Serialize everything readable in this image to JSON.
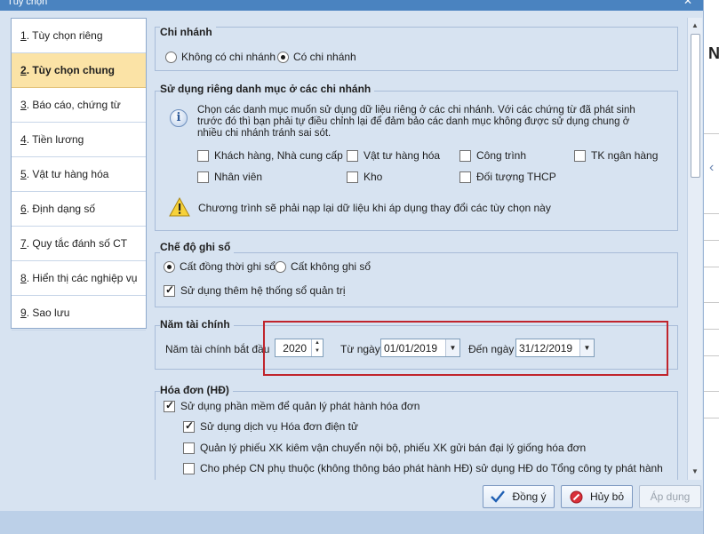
{
  "window": {
    "title": "Tùy chọn",
    "close_glyph": "✕"
  },
  "nav": [
    {
      "num": "1",
      "label": ". Tùy chọn riêng",
      "active": false
    },
    {
      "num": "2",
      "label": ". Tùy chọn chung",
      "active": true
    },
    {
      "num": "3",
      "label": ". Báo cáo, chứng từ",
      "active": false
    },
    {
      "num": "4",
      "label": ". Tiền lương",
      "active": false
    },
    {
      "num": "5",
      "label": ". Vật tư hàng hóa",
      "active": false
    },
    {
      "num": "6",
      "label": ". Định dạng số",
      "active": false
    },
    {
      "num": "7",
      "label": ". Quy tắc đánh số CT",
      "active": false
    },
    {
      "num": "8",
      "label": ". Hiển thị các nghiệp vụ",
      "active": false
    },
    {
      "num": "9",
      "label": ". Sao lưu",
      "active": false
    }
  ],
  "branch": {
    "title": "Chi nhánh",
    "option_none": "Không có chi nhánh",
    "option_has": "Có chi nhánh",
    "selected": "Có chi nhánh"
  },
  "catalog": {
    "title": "Sử dụng riêng danh mục ở các chi nhánh",
    "info": "Chọn các danh mục muốn sử dụng dữ liệu riêng ở các chi nhánh. Với các chứng từ đã phát sinh trước đó thì bạn phải tự điều chỉnh lại để đảm bảo các danh mục không được sử dụng chung ở nhiều chi nhánh tránh sai sót.",
    "items": [
      {
        "label": "Khách hàng, Nhà cung cấp",
        "checked": false
      },
      {
        "label": "Vật tư hàng hóa",
        "checked": false
      },
      {
        "label": "Công trình",
        "checked": false
      },
      {
        "label": "TK ngân hàng",
        "checked": false
      },
      {
        "label": "Nhân viên",
        "checked": false
      },
      {
        "label": "Kho",
        "checked": false
      },
      {
        "label": "Đối tượng THCP",
        "checked": false
      }
    ],
    "warning": "Chương trình sẽ phải nạp lại dữ liệu khi áp dụng thay đổi các tùy chọn này"
  },
  "ledger": {
    "title": "Chế độ ghi sổ",
    "option_both": "Cất đồng thời ghi sổ",
    "option_no": "Cất không ghi sổ",
    "selected": "Cất đồng thời ghi sổ",
    "mgmt_label": "Sử dụng thêm hệ thống sổ quản trị",
    "mgmt_checked": true
  },
  "fiscal": {
    "title": "Năm tài chính",
    "start_year_label": "Năm tài chính bắt đầu",
    "start_year": "2020",
    "from_label": "Từ ngày",
    "from_date": "01/01/2019",
    "to_label": "Đến ngày",
    "to_date": "31/12/2019"
  },
  "invoice": {
    "title": "Hóa đơn (HĐ)",
    "items": [
      {
        "label": "Sử dụng phần mềm để quản lý phát hành hóa đơn",
        "checked": true
      },
      {
        "label": "Sử dụng dịch vụ Hóa đơn điện tử",
        "checked": true
      },
      {
        "label": "Quản lý phiếu XK kiêm vận chuyển nội bộ, phiếu XK gửi bán đại lý giống hóa đơn",
        "checked": false
      },
      {
        "label": "Cho phép CN phụ thuộc (không thông báo phát hành HĐ) sử dụng HĐ do Tổng công ty phát hành",
        "checked": false
      }
    ]
  },
  "buttons": {
    "ok": "Đồng ý",
    "cancel": "Hủy bỏ",
    "apply": "Áp dụng"
  },
  "colors": {
    "accent": "#4a83c0",
    "panel": "#d7e3f1",
    "active_nav": "#fbe3a6",
    "highlight": "#c0242c"
  },
  "background_app": {
    "letter": "N"
  }
}
